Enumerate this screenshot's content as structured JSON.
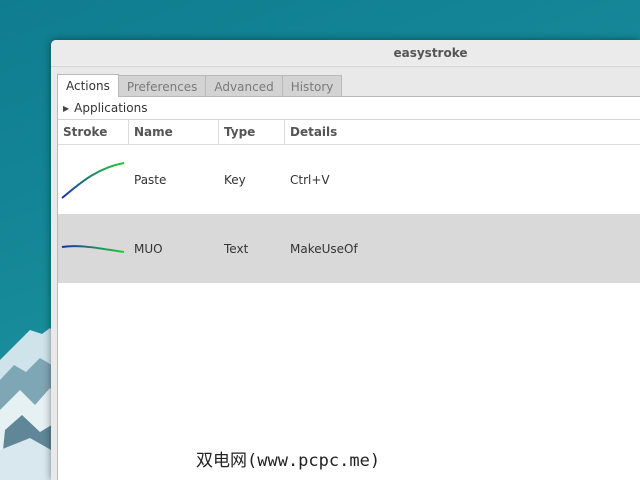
{
  "window": {
    "title": "easystroke"
  },
  "tabs": [
    {
      "label": "Actions"
    },
    {
      "label": "Preferences"
    },
    {
      "label": "Advanced"
    },
    {
      "label": "History"
    }
  ],
  "applications_label": "Applications",
  "table": {
    "columns": [
      "Stroke",
      "Name",
      "Type",
      "Details"
    ],
    "rows": [
      {
        "name": "Paste",
        "type": "Key",
        "details": "Ctrl+V"
      },
      {
        "name": "MUO",
        "type": "Text",
        "details": "MakeUseOf"
      }
    ]
  },
  "watermark": "双电网(www.pcpc.me)",
  "colors": {
    "desktop": "#138596",
    "selected_row": "#d9d9d9",
    "stroke_start": "#1a2fb0",
    "stroke_end": "#22cc33"
  }
}
